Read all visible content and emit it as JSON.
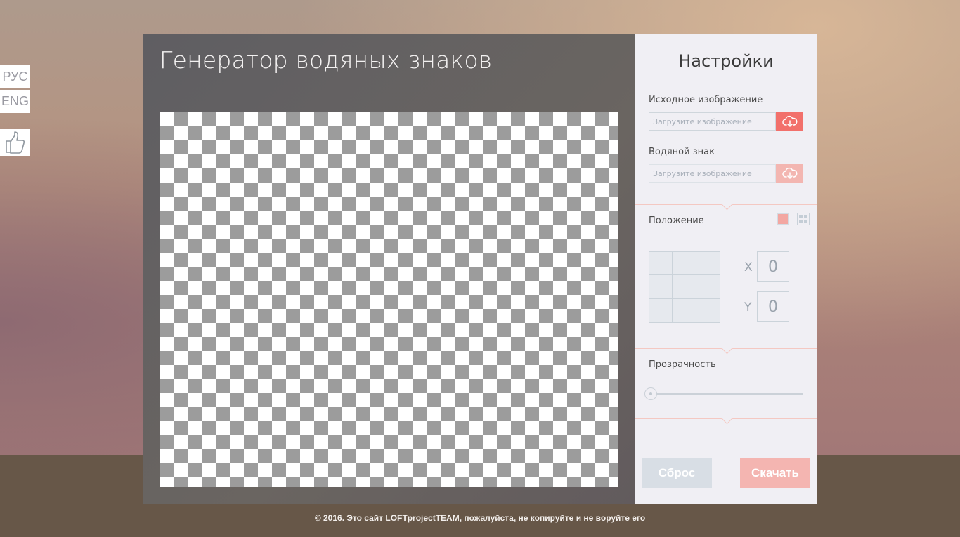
{
  "lang": {
    "ru": "РУС",
    "en": "ENG"
  },
  "main": {
    "title": "Генератор водяных знаков"
  },
  "settings": {
    "title": "Настройки",
    "source": {
      "label": "Исходное изображение",
      "placeholder": "Загрузите изображение"
    },
    "watermark": {
      "label": "Водяной знак",
      "placeholder": "Загрузите изображение"
    },
    "position": {
      "label": "Положение",
      "x_label": "X",
      "y_label": "Y",
      "x": "0",
      "y": "0"
    },
    "opacity": {
      "label": "Прозрачность",
      "value": 0
    },
    "reset_label": "Сброс",
    "download_label": "Скачать"
  },
  "footer": {
    "text": "© 2016. Это сайт LOFTprojectTEAM, пожалуйста, не копируйте и не воруйте его"
  },
  "colors": {
    "accent": "#f2706b",
    "accent_disabled": "#f3b6b1",
    "panel_bg": "#f0eff4"
  },
  "icons": [
    "like-icon",
    "cloud-upload-icon",
    "position-single-icon",
    "position-tile-icon"
  ]
}
